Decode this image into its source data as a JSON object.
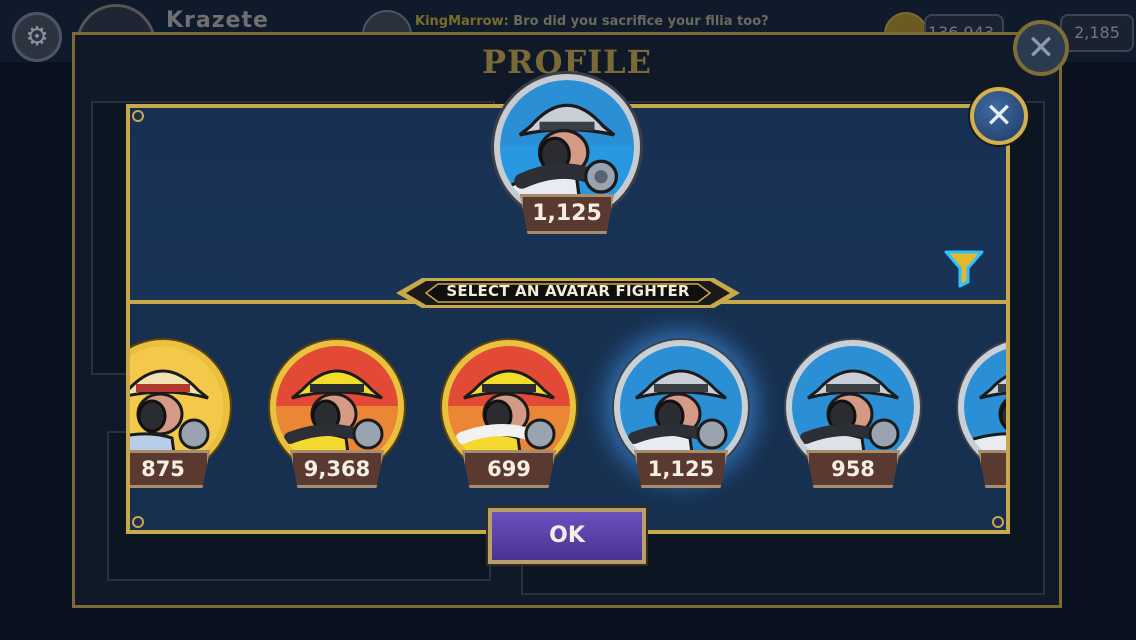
{
  "topbar": {
    "username": "Krazete",
    "chat_sender": "KingMarrow:",
    "chat_message": " Bro did you sacrifice your filia too?",
    "coins": "136,943",
    "gems": "2,185"
  },
  "profile": {
    "title": "PROFILE",
    "close_symbol": "✕"
  },
  "modal": {
    "close_symbol": "✕",
    "selected_value": "1,125",
    "banner": "SELECT AN AVATAR FIGHTER",
    "ok_label": "OK"
  },
  "fighters": [
    {
      "value": "875",
      "frame": "gold",
      "palette": "cream-blue"
    },
    {
      "value": "9,368",
      "frame": "gold",
      "palette": "yellow-red"
    },
    {
      "value": "699",
      "frame": "gold",
      "palette": "yellow-red"
    },
    {
      "value": "1,125",
      "frame": "silver",
      "palette": "gray-blue",
      "selected": true
    },
    {
      "value": "958",
      "frame": "silver",
      "palette": "gray-blue"
    },
    {
      "value": "",
      "frame": "silver",
      "palette": "gray-blue"
    }
  ],
  "colors": {
    "accent_gold": "#c8a94a",
    "ok_button": "#5a3fa6",
    "value_badge": "#5a3a30",
    "modal_bg": "#173052"
  }
}
